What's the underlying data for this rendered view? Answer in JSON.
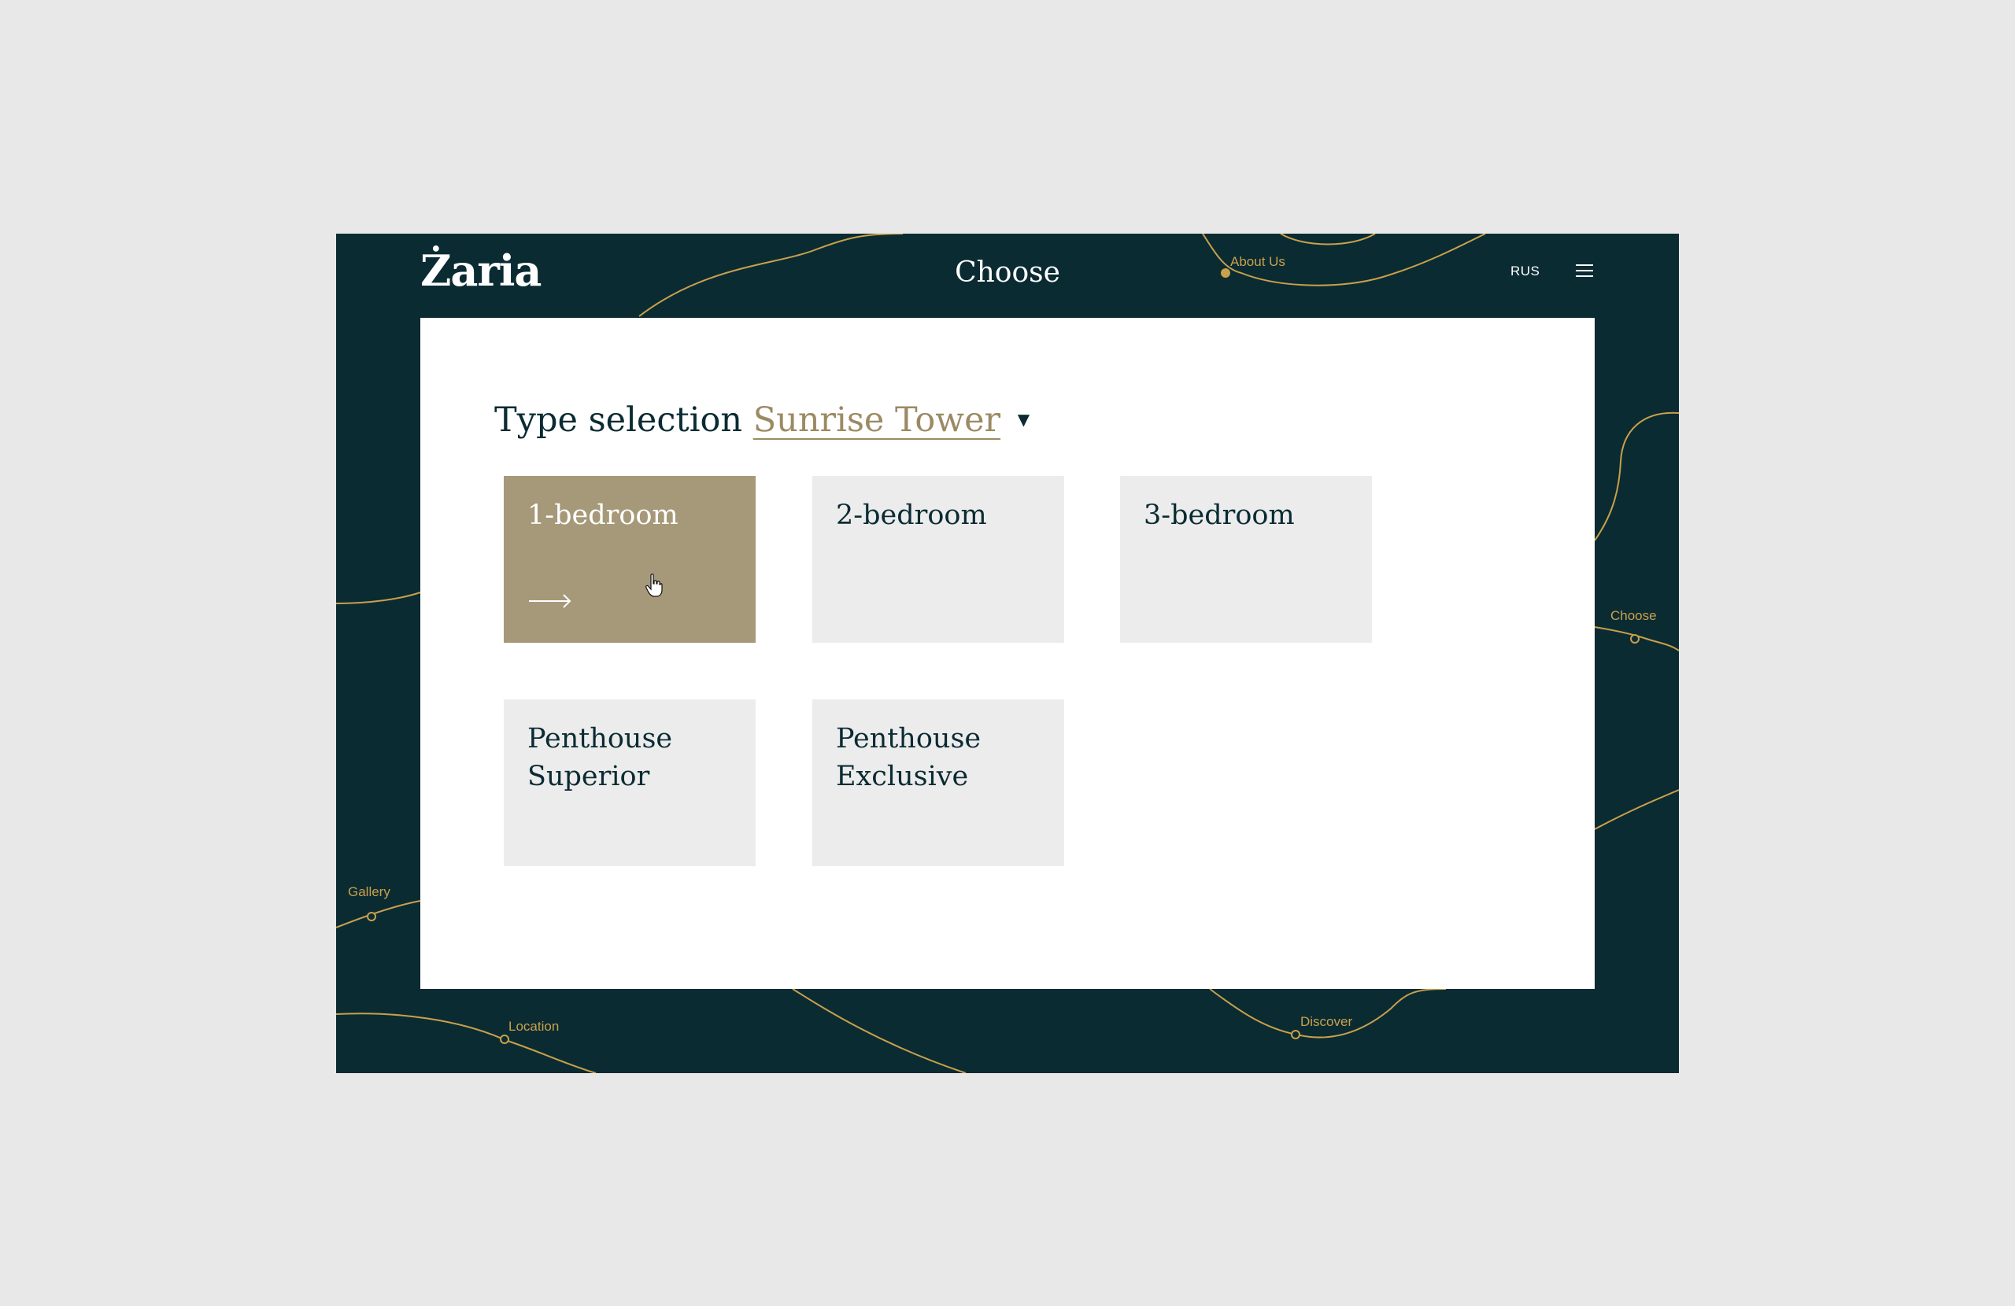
{
  "header": {
    "logo": "Żaria",
    "title": "Choose",
    "language": "RUS"
  },
  "routes": {
    "about": "About Us",
    "choose": "Choose",
    "gallery": "Gallery",
    "location": "Location",
    "discover": "Discover"
  },
  "selection": {
    "heading": "Type selection",
    "tower": "Sunrise Tower"
  },
  "apartment_types": [
    {
      "label": "1-bedroom",
      "active": true
    },
    {
      "label": "2-bedroom",
      "active": false
    },
    {
      "label": "3-bedroom",
      "active": false
    },
    {
      "label": "Penthouse\nSuperior",
      "active": false
    },
    {
      "label": "Penthouse\nExclusive",
      "active": false
    }
  ],
  "colors": {
    "frame_bg": "#0b2b33",
    "route_line": "#c9a14a",
    "active_tile": "#a59979",
    "inactive_tile": "#ececec",
    "tower_link": "#9b8a63"
  }
}
